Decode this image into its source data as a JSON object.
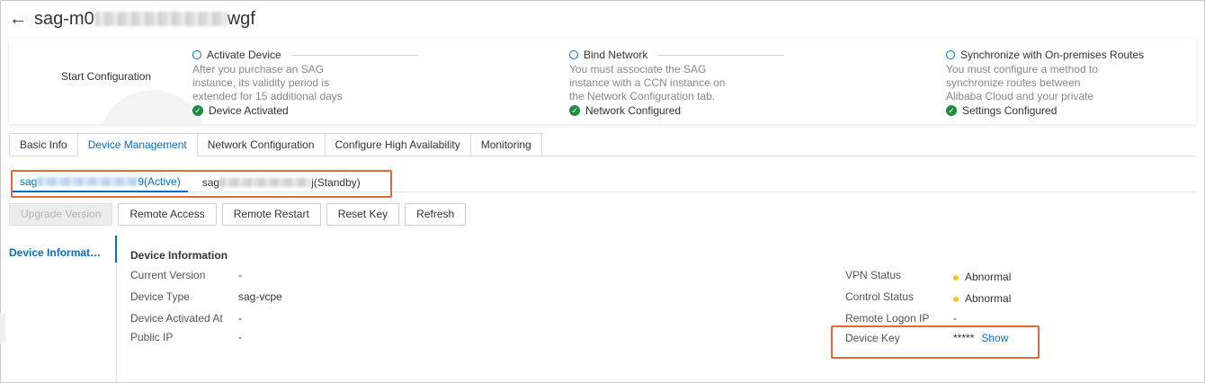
{
  "header": {
    "title_prefix": "sag-m0",
    "title_suffix": "wgf"
  },
  "config": {
    "start_label": "Start Configuration",
    "steps": [
      {
        "title": "Activate Device",
        "desc": "After you purchase an SAG instance, its validity period is extended for 15 additional days",
        "status": "Device Activated"
      },
      {
        "title": "Bind Network",
        "desc": "You must associate the SAG instance with a CCN instance on the Network Configuration tab.",
        "status": "Network Configured"
      },
      {
        "title": "Synchronize with On-premises Routes",
        "desc": "You must configure a method to synchronize routes between Alibaba Cloud and your private",
        "status": "Settings Configured"
      }
    ]
  },
  "tabs": [
    "Basic Info",
    "Device Management",
    "Network Configuration",
    "Configure High Availability",
    "Monitoring"
  ],
  "device_tabs": {
    "active_prefix": "sag",
    "active_suffix": "9(Active)",
    "standby_prefix": "sag",
    "standby_suffix": "j(Standby)"
  },
  "actions": {
    "upgrade": "Upgrade Version",
    "remote_access": "Remote Access",
    "remote_restart": "Remote Restart",
    "reset_key": "Reset Key",
    "refresh": "Refresh"
  },
  "side_nav": {
    "item": "Device Informat…"
  },
  "device_info": {
    "title": "Device Information",
    "left": [
      {
        "key": "Current Version",
        "value": "-"
      },
      {
        "key": "Device Type",
        "value": "sag-vcpe"
      },
      {
        "key": "Device Activated At",
        "value": "-"
      },
      {
        "key": "Public IP",
        "value": "-"
      }
    ],
    "right": {
      "vpn_status_key": "VPN Status",
      "vpn_status_value": "Abnormal",
      "control_status_key": "Control Status",
      "control_status_value": "Abnormal",
      "remote_logon_key": "Remote Logon IP",
      "remote_logon_value": "-",
      "device_key_key": "Device Key",
      "device_key_value": "*****",
      "show_link": "Show"
    }
  },
  "colors": {
    "accent": "#0070cc",
    "success": "#1e8e3e",
    "warning": "#f5c518",
    "highlight": "#e8663c"
  }
}
